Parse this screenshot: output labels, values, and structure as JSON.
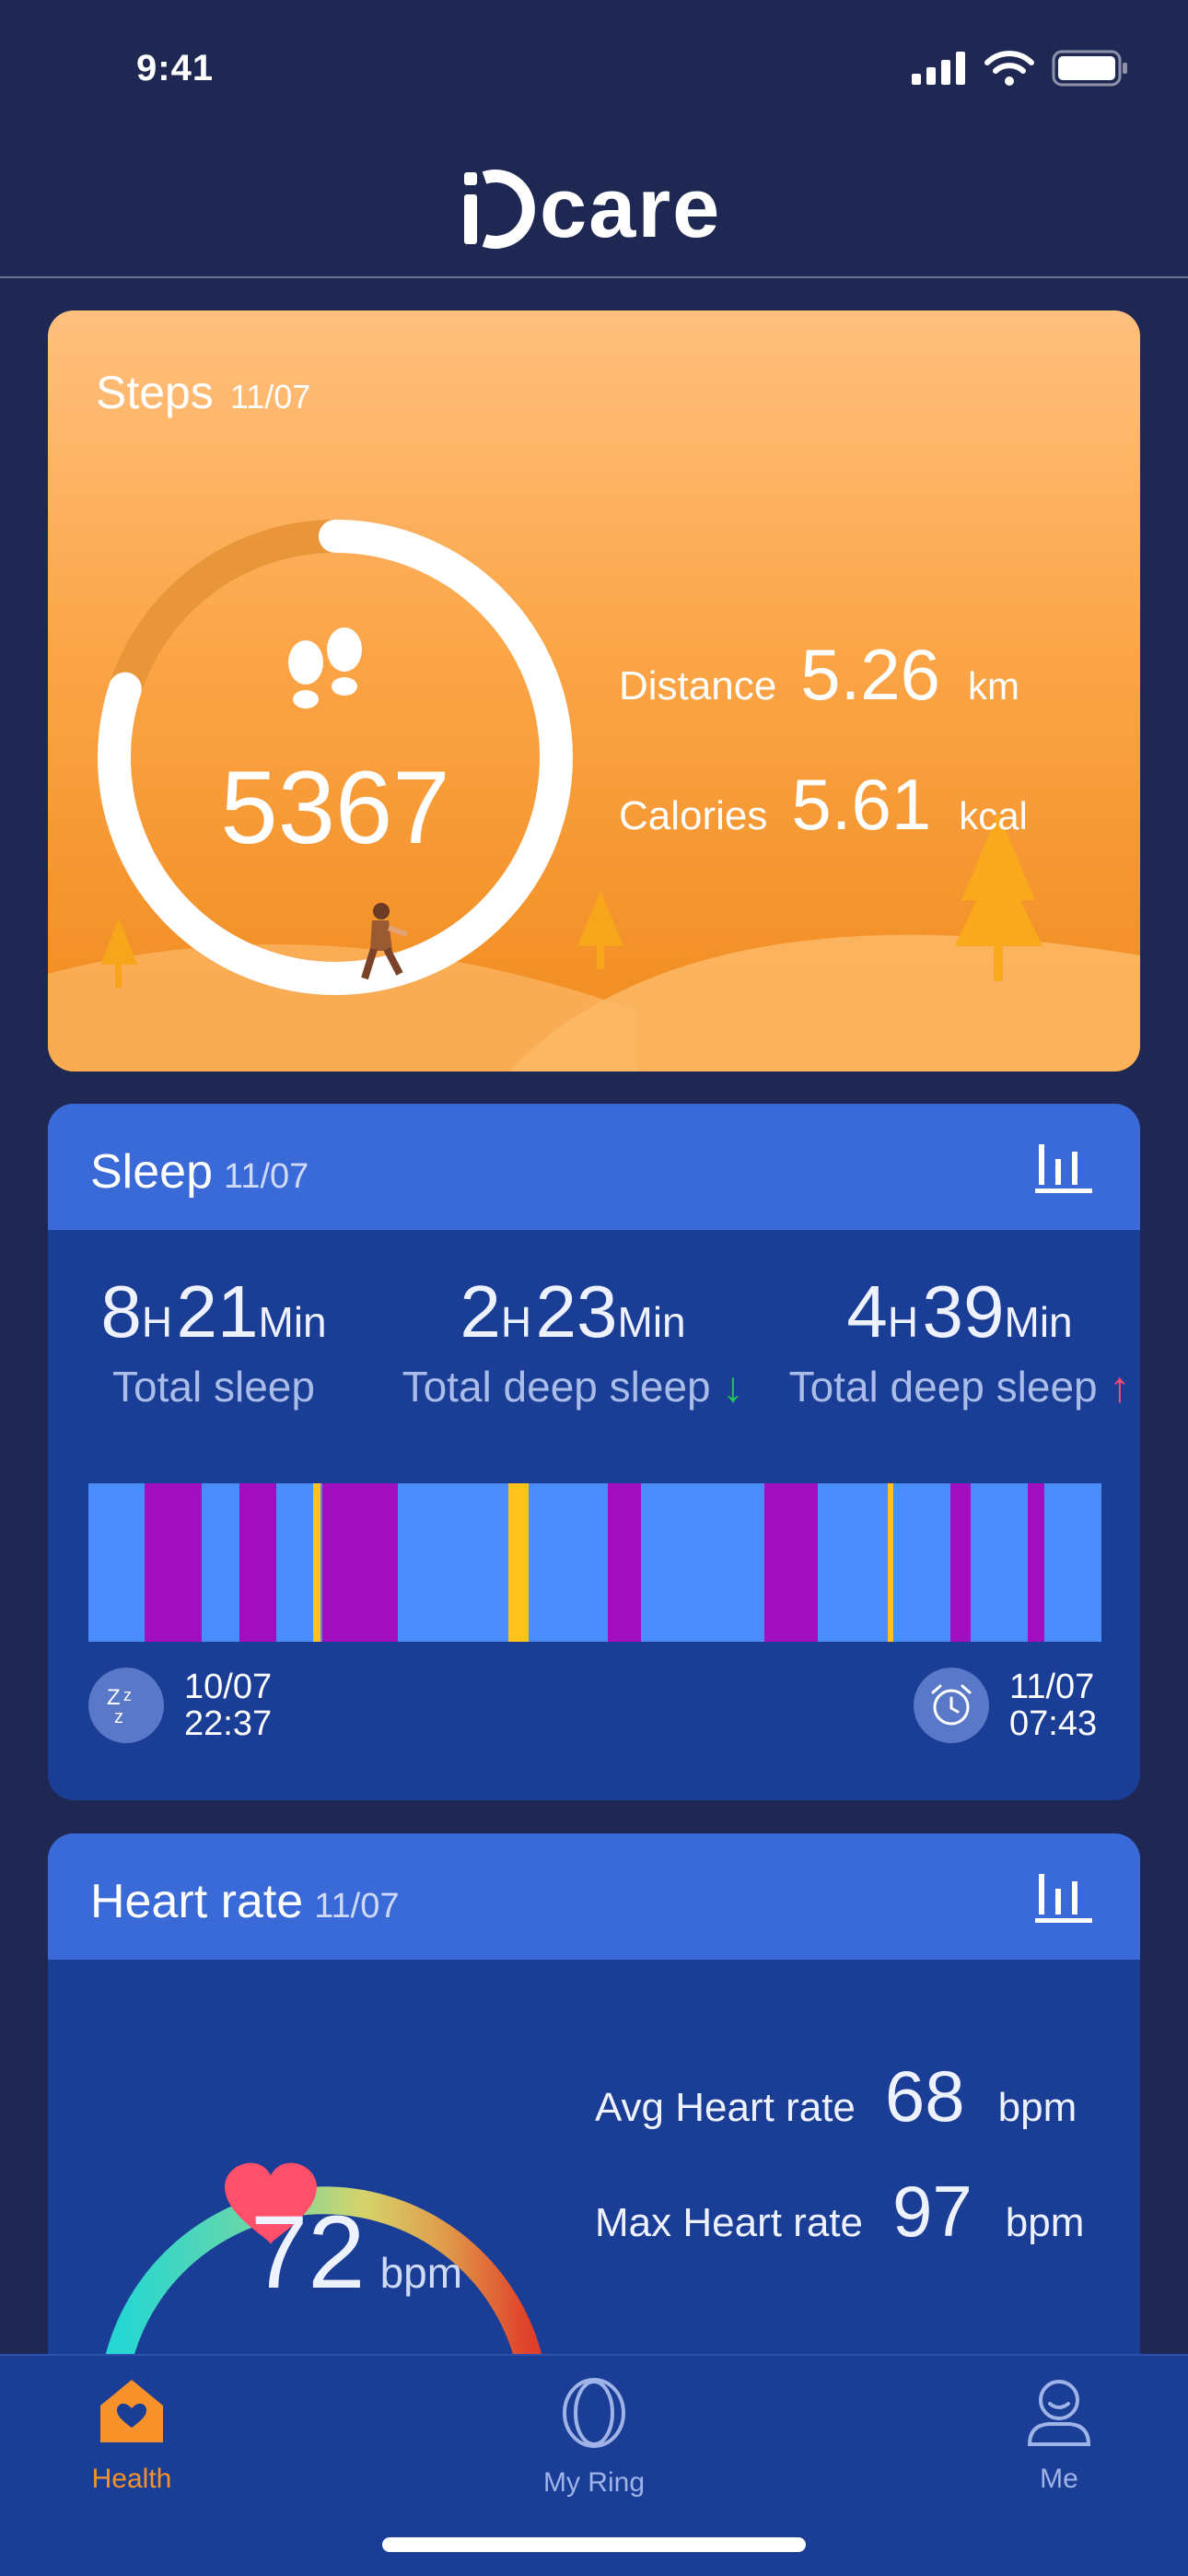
{
  "status_bar": {
    "time": "9:41"
  },
  "app": {
    "logo": "care"
  },
  "steps": {
    "title": "Steps",
    "date": "11/07",
    "count": "5367",
    "progress": 0.8,
    "distance_label": "Distance",
    "distance_value": "5.26",
    "distance_unit": "km",
    "calories_label": "Calories",
    "calories_value": "5.61",
    "calories_unit": "kcal"
  },
  "sleep": {
    "title": "Sleep",
    "date": "11/07",
    "total": {
      "hours": "8",
      "h_unit": "H",
      "minutes": "21",
      "m_unit": "Min",
      "label": "Total sleep"
    },
    "deep": {
      "hours": "2",
      "h_unit": "H",
      "minutes": "23",
      "m_unit": "Min",
      "label": "Total deep sleep",
      "arrow": "↓"
    },
    "light": {
      "hours": "4",
      "h_unit": "H",
      "minutes": "39",
      "m_unit": "Min",
      "label": "Total deep sleep",
      "arrow": "↑"
    },
    "start_date": "10/07",
    "start_time": "22:37",
    "end_date": "11/07",
    "end_time": "07:43",
    "colors": {
      "light": "#4a8cfb",
      "deep": "#a30fc0",
      "awake": "#ffc21c"
    }
  },
  "heart": {
    "title": "Heart rate",
    "date": "11/07",
    "value": "72",
    "unit": "bpm",
    "avg_label": "Avg Heart rate",
    "avg_value": "68",
    "avg_unit": "bpm",
    "max_label": "Max Heart rate",
    "max_value": "97",
    "max_unit": "bpm"
  },
  "nav": {
    "health": "Health",
    "ring": "My Ring",
    "me": "Me",
    "active_color": "#f7922a",
    "inactive_color": "#9fb3e6"
  }
}
